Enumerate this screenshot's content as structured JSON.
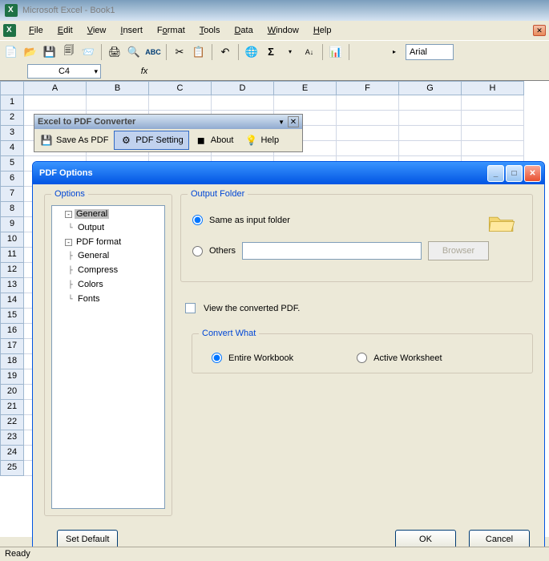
{
  "app_title": "Microsoft Excel - Book1",
  "menus": {
    "file": "File",
    "edit": "Edit",
    "view": "View",
    "insert": "Insert",
    "format": "Format",
    "tools": "Tools",
    "data": "Data",
    "window": "Window",
    "help": "Help"
  },
  "font_name": "Arial",
  "namebox": "C4",
  "columns": [
    "A",
    "B",
    "C",
    "D",
    "E",
    "F",
    "G",
    "H"
  ],
  "rows": [
    "1",
    "2",
    "3",
    "4",
    "5",
    "6",
    "7",
    "8",
    "9",
    "10",
    "11",
    "12",
    "13",
    "14",
    "15",
    "16",
    "17",
    "18",
    "19",
    "20",
    "21",
    "22",
    "23",
    "24",
    "25"
  ],
  "converter": {
    "title": "Excel to PDF Converter",
    "save": "Save As PDF",
    "setting": "PDF Setting",
    "about": "About",
    "help": "Help"
  },
  "dialog": {
    "title": "PDF Options",
    "options_legend": "Options",
    "tree": {
      "general": "General",
      "output": "Output",
      "pdf_format": "PDF format",
      "general2": "General",
      "compress": "Compress",
      "colors": "Colors",
      "fonts": "Fonts"
    },
    "output_legend": "Output Folder",
    "same_as_input": "Same as input folder",
    "others": "Others",
    "browser": "Browser",
    "view_converted": "View the converted PDF.",
    "convert_legend": "Convert What",
    "entire_workbook": "Entire Workbook",
    "active_worksheet": "Active Worksheet",
    "set_default": "Set Default",
    "ok": "OK",
    "cancel": "Cancel"
  },
  "status": "Ready"
}
